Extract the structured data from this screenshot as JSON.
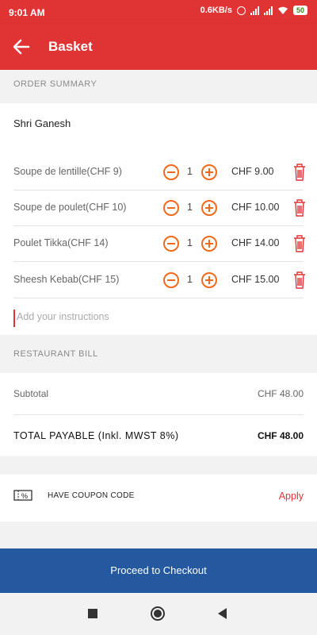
{
  "status_bar": {
    "time": "9:01 AM",
    "network_speed": "0.6KB/s",
    "battery": "50"
  },
  "app_bar": {
    "title": "Basket",
    "back_icon": "arrow-left-icon"
  },
  "order_summary": {
    "header": "ORDER SUMMARY",
    "restaurant": "Shri Ganesh",
    "items": [
      {
        "name": "Soupe de lentille(CHF 9)",
        "qty": "1",
        "price": "CHF 9.00"
      },
      {
        "name": "Soupe de poulet(CHF 10)",
        "qty": "1",
        "price": "CHF 10.00"
      },
      {
        "name": "Poulet Tikka(CHF 14)",
        "qty": "1",
        "price": "CHF 14.00"
      },
      {
        "name": "Sheesh Kebab(CHF 15)",
        "qty": "1",
        "price": "CHF 15.00"
      }
    ],
    "instructions_placeholder": "Add your instructions"
  },
  "restaurant_bill": {
    "header": "RESTAURANT BILL",
    "subtotal_label": "Subtotal",
    "subtotal_value": "CHF 48.00",
    "total_label": "TOTAL PAYABLE (Inkl. MWST 8%)",
    "total_value": "CHF 48.00"
  },
  "coupon": {
    "label": "HAVE COUPON CODE",
    "apply_label": "Apply",
    "icon": "coupon-percent-icon"
  },
  "checkout": {
    "label": "Proceed to Checkout"
  },
  "colors": {
    "primary": "#e03434",
    "accent": "#f06a1a",
    "checkout": "#2459a0"
  }
}
